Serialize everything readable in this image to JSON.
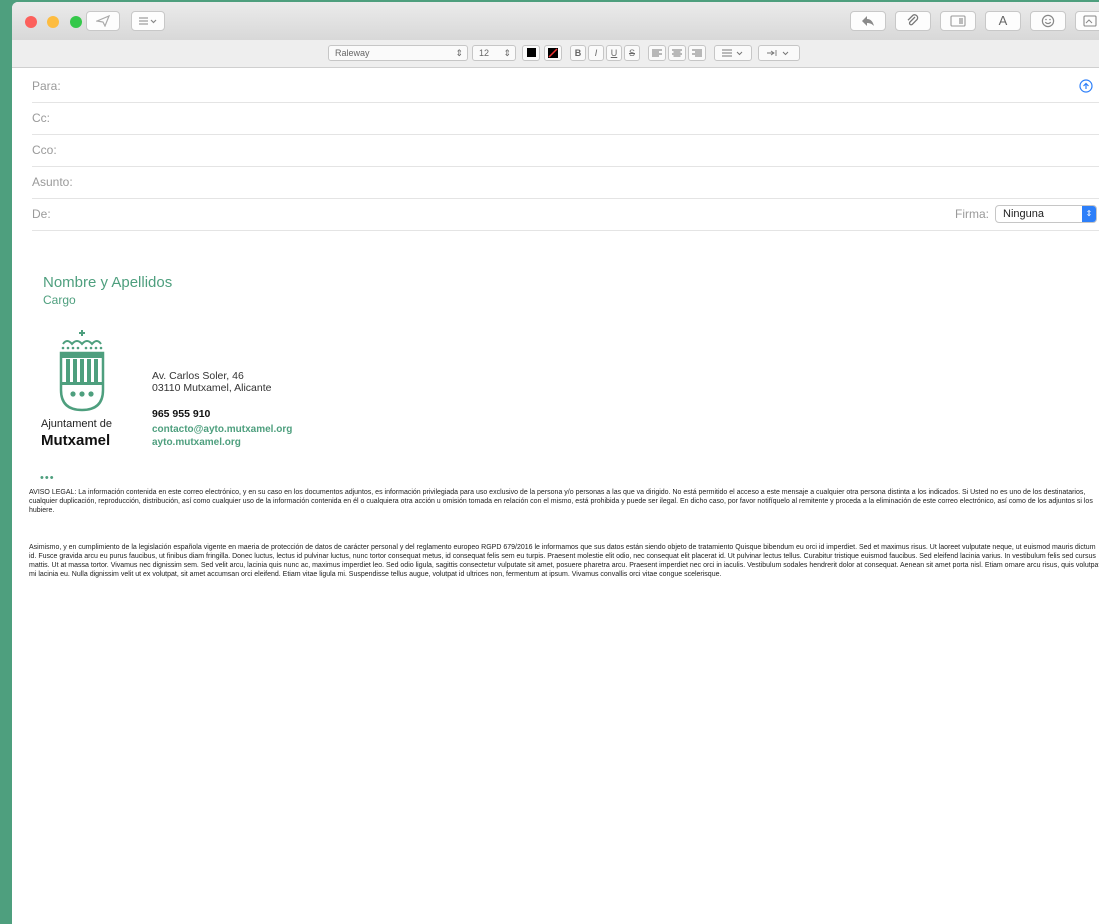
{
  "compose": {
    "fields": [
      {
        "label": "Para:"
      },
      {
        "label": "Cc:"
      },
      {
        "label": "Cco:"
      },
      {
        "label": "Asunto:"
      },
      {
        "label": "De:"
      }
    ],
    "firma_label": "Firma:",
    "firma_value": "Ninguna"
  },
  "format_bar": {
    "font": "Raleway",
    "size": "12",
    "bold": "B",
    "italic": "I",
    "underline": "U",
    "strike": "S"
  },
  "toolbar": {
    "font_button": "A"
  },
  "signature": {
    "name": "Nombre y Apellidos",
    "role": "Cargo",
    "logo_line1": "Ajuntament de",
    "logo_line2": "Mutxamel",
    "address1": "Av. Carlos Soler, 46",
    "address2": "03110 Mutxamel, Alicante",
    "phone": "965 955 910",
    "email": "contacto@ayto.mutxamel.org",
    "web": "ayto.mutxamel.org",
    "dots": "•••",
    "legal1": "AVISO LEGAL: La información contenida en este correo electrónico, y en su caso en los documentos adjuntos, es información privilegiada para uso exclusivo de la persona y/o personas a las que va dirigido. No está permitido el acceso a este mensaje a cualquier otra persona distinta a los indicados. Si Usted no es uno de los destinatarios, cualquier duplicación, reproducción, distribución, así como cualquier uso de la información contenida en él o cualquiera otra acción u omisión tomada en relación con el mismo, está prohibida y puede ser ilegal. En dicho caso, por favor notifíquelo al remitente y proceda a la eliminación de este correo electrónico, así como de los adjuntos si los hubiere.",
    "legal2": "Asimismo, y en cumplimiento de la legislación española vigente en maeria de protección de datos de carácter personal y del reglamento europeo RGPD 679/2016 le informamos que sus datos están siendo objeto de tratamiento Quisque bibendum eu orci id imperdiet. Sed et maximus risus. Ut laoreet vulputate neque, ut euismod mauris dictum id. Fusce gravida arcu eu purus faucibus, ut finibus diam fringilla. Donec luctus, lectus id pulvinar luctus, nunc tortor consequat metus, id consequat felis sem eu turpis. Praesent molestie elit odio, nec consequat elit placerat id. Ut pulvinar lectus tellus. Curabitur tristique euismod faucibus. Sed eleifend lacinia varius. In vestibulum felis sed cursus mattis. Ut at massa tortor. Vivamus nec dignissim sem. Sed velit arcu, lacinia quis nunc ac, maximus imperdiet leo. Sed odio ligula, sagittis consectetur vulputate sit amet, posuere pharetra arcu. Praesent imperdiet nec orci in iaculis. Vestibulum sodales hendrerit dolor at consequat. Aenean sit amet porta nisl. Etiam ornare arcu risus, quis volutpat mi lacinia eu. Nulla dignissim velit ut ex volutpat, sit amet accumsan orci eleifend. Etiam vitae ligula mi. Suspendisse tellus augue, volutpat id ultrices non, fermentum at ipsum. Vivamus convallis orci vitae congue scelerisque."
  },
  "colors": {
    "brand": "#4e9f7e",
    "close": "#fc605c",
    "minimize": "#fdbc40",
    "zoom": "#34c84a",
    "info_blue": "#2d7ff9"
  },
  "icons": [
    "send-icon",
    "header-fields-icon",
    "reply-icon",
    "attachment-icon",
    "photo-browser-icon",
    "emoji-icon",
    "add-contact-icon"
  ]
}
